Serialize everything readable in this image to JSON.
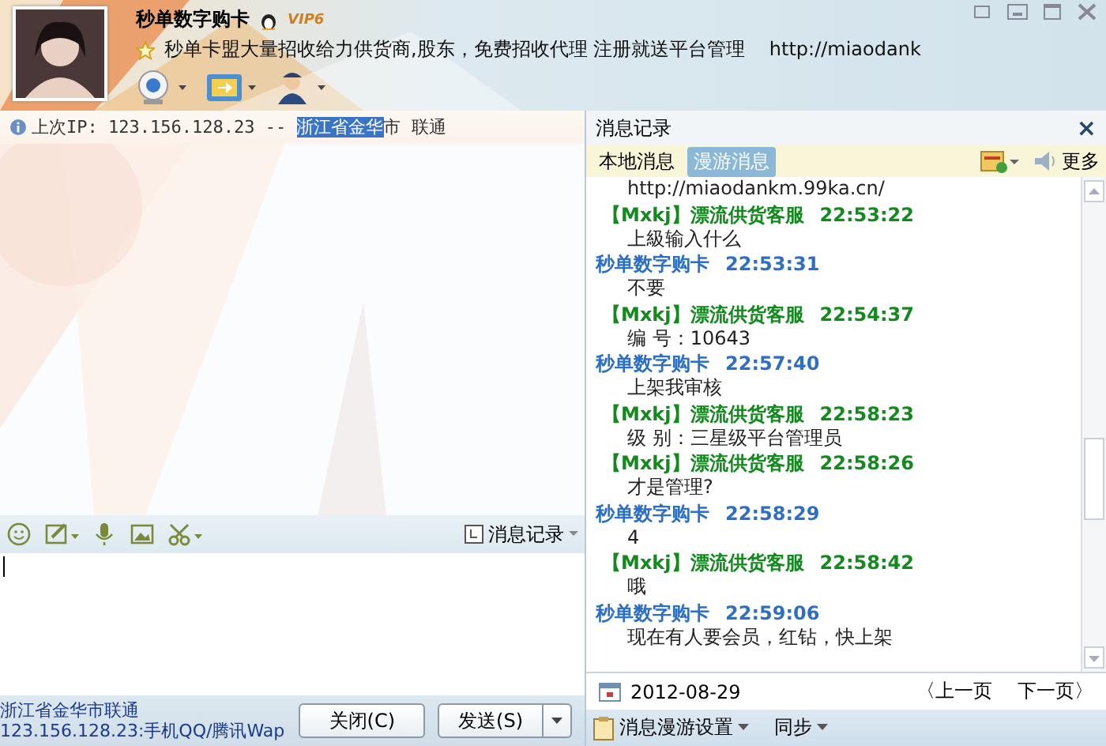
{
  "contact": {
    "name": "秒单数字购卡",
    "badge": "VIP6",
    "signature": "秒单卡盟大量招收给力供货商,股东，免费招收代理 注册就送平台管理    http://miaodank"
  },
  "ip_bar": {
    "segments": [
      {
        "text": "上次IP: 123.156.128.23 -- ",
        "selected": false
      },
      {
        "text": "浙江省金华",
        "selected": true
      },
      {
        "text": "市 联通",
        "selected": false
      }
    ]
  },
  "compose": {
    "history_button": "消息记录",
    "location": "浙江省金华市联通",
    "source": "123.156.128.23:手机QQ/腾讯Wap",
    "buttons": [
      {
        "label": "关闭(C)",
        "kind": "plain"
      },
      {
        "label": "发送(S)",
        "kind": "split"
      }
    ]
  },
  "history": {
    "title": "消息记录",
    "close": "×",
    "tabs": [
      {
        "label": "本地消息",
        "selected": false
      },
      {
        "label": "漫游消息",
        "selected": true
      }
    ],
    "more": "更多",
    "messages": [
      {
        "kind": "fragment",
        "body": "http://miaodankm.99ka.cn/"
      },
      {
        "kind": "contact",
        "sender": "【Mxkj】漂流供货客服",
        "time": "22:53:22",
        "body": "上級输入什么"
      },
      {
        "kind": "self",
        "sender": "秒单数字购卡",
        "time": "22:53:31",
        "body": "不要"
      },
      {
        "kind": "contact",
        "sender": "【Mxkj】漂流供货客服",
        "time": "22:54:37",
        "body": "编 号：10643"
      },
      {
        "kind": "self",
        "sender": "秒单数字购卡",
        "time": "22:57:40",
        "body": "上架我审核"
      },
      {
        "kind": "contact",
        "sender": "【Mxkj】漂流供货客服",
        "time": "22:58:23",
        "body": "级 别：三星级平台管理员"
      },
      {
        "kind": "contact",
        "sender": "【Mxkj】漂流供货客服",
        "time": "22:58:26",
        "body": "才是管理?"
      },
      {
        "kind": "self",
        "sender": "秒单数字购卡",
        "time": "22:58:29",
        "body": "4"
      },
      {
        "kind": "contact",
        "sender": "【Mxkj】漂流供货客服",
        "time": "22:58:42",
        "body": "哦"
      },
      {
        "kind": "self",
        "sender": "秒单数字购卡",
        "time": "22:59:06",
        "body": "现在有人要会员，红钻，快上架"
      }
    ],
    "date": "2012-08-29",
    "prev_page": "〈上一页",
    "next_page": "下一页〉",
    "roaming_settings": "消息漫游设置",
    "sync": "同步"
  }
}
